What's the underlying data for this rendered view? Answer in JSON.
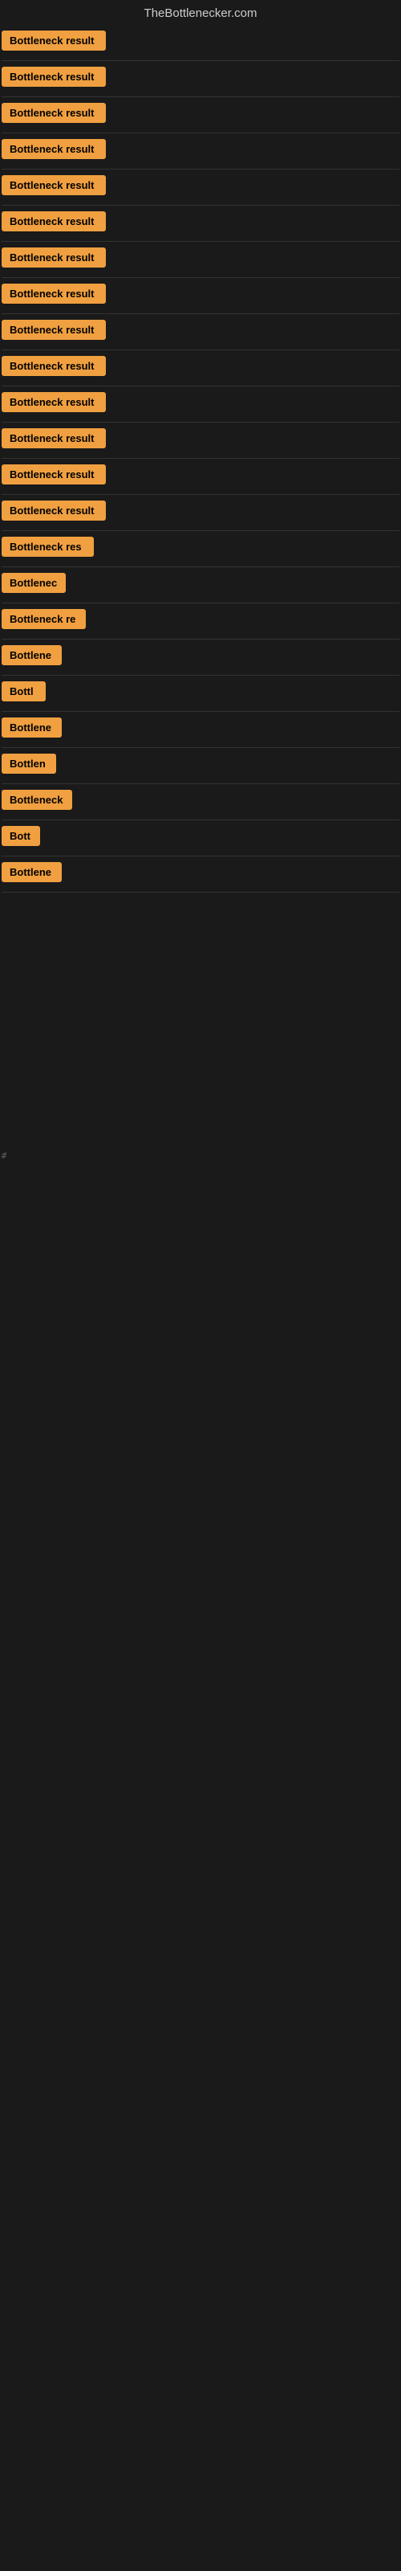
{
  "site": {
    "title": "TheBottlenecker.com"
  },
  "items": [
    {
      "id": 1,
      "label": "Bottleneck result",
      "width": 130
    },
    {
      "id": 2,
      "label": "Bottleneck result",
      "width": 130
    },
    {
      "id": 3,
      "label": "Bottleneck result",
      "width": 130
    },
    {
      "id": 4,
      "label": "Bottleneck result",
      "width": 130
    },
    {
      "id": 5,
      "label": "Bottleneck result",
      "width": 130
    },
    {
      "id": 6,
      "label": "Bottleneck result",
      "width": 130
    },
    {
      "id": 7,
      "label": "Bottleneck result",
      "width": 130
    },
    {
      "id": 8,
      "label": "Bottleneck result",
      "width": 130
    },
    {
      "id": 9,
      "label": "Bottleneck result",
      "width": 130
    },
    {
      "id": 10,
      "label": "Bottleneck result",
      "width": 130
    },
    {
      "id": 11,
      "label": "Bottleneck result",
      "width": 130
    },
    {
      "id": 12,
      "label": "Bottleneck result",
      "width": 130
    },
    {
      "id": 13,
      "label": "Bottleneck result",
      "width": 130
    },
    {
      "id": 14,
      "label": "Bottleneck result",
      "width": 130
    },
    {
      "id": 15,
      "label": "Bottleneck res",
      "width": 115
    },
    {
      "id": 16,
      "label": "Bottlenec",
      "width": 80
    },
    {
      "id": 17,
      "label": "Bottleneck re",
      "width": 105
    },
    {
      "id": 18,
      "label": "Bottlene",
      "width": 75
    },
    {
      "id": 19,
      "label": "Bottl",
      "width": 55
    },
    {
      "id": 20,
      "label": "Bottlene",
      "width": 75
    },
    {
      "id": 21,
      "label": "Bottlen",
      "width": 68
    },
    {
      "id": 22,
      "label": "Bottleneck",
      "width": 88
    },
    {
      "id": 23,
      "label": "Bott",
      "width": 48
    },
    {
      "id": 24,
      "label": "Bottlene",
      "width": 75
    }
  ],
  "colors": {
    "badge_bg": "#f0a040",
    "badge_text": "#000000",
    "background": "#1a1a1a",
    "title_text": "#cccccc"
  }
}
